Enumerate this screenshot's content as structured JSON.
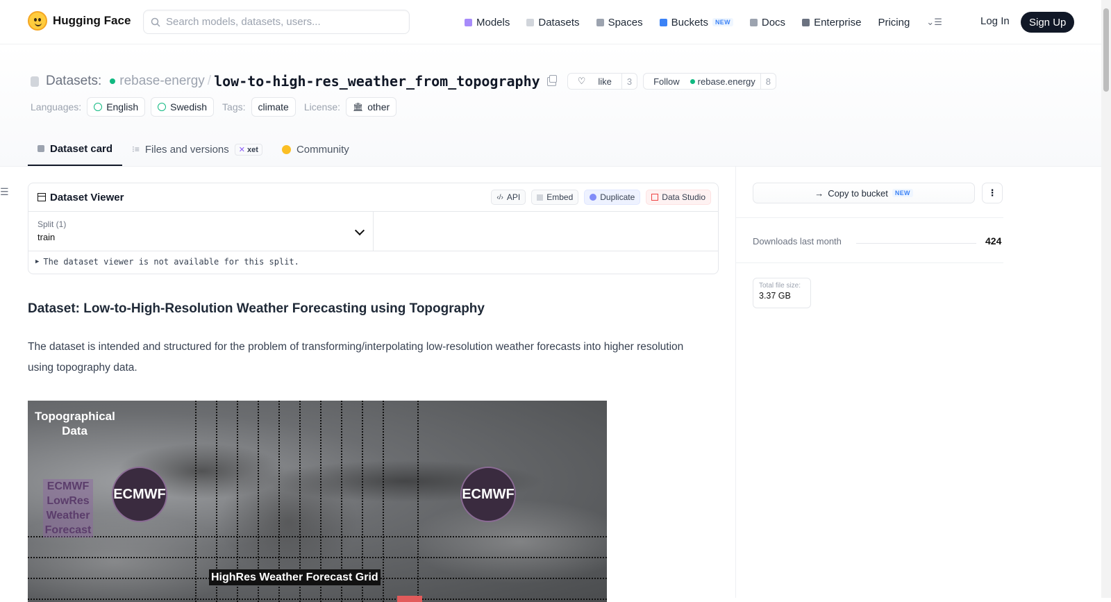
{
  "nav": {
    "logo_text": "Hugging Face",
    "search_placeholder": "Search models, datasets, users...",
    "items": [
      {
        "label": "Models",
        "icon": "models-icon",
        "color": "#a78bfa"
      },
      {
        "label": "Datasets",
        "icon": "datasets-icon",
        "color": "#d1d5db"
      },
      {
        "label": "Spaces",
        "icon": "spaces-icon",
        "color": "#9ca3af"
      },
      {
        "label": "Buckets",
        "icon": "buckets-icon",
        "color": "#3b82f6",
        "badge": "NEW"
      },
      {
        "label": "Docs",
        "icon": "docs-icon",
        "color": "#9ca3af"
      },
      {
        "label": "Enterprise",
        "icon": "enterprise-icon",
        "color": "#6b7280"
      },
      {
        "label": "Pricing"
      }
    ],
    "login": "Log In",
    "signup": "Sign Up"
  },
  "header": {
    "crumb": "Datasets:",
    "org": "rebase-energy",
    "repo": "low-to-high-res_weather_from_topography",
    "like_label": "like",
    "like_count": "3",
    "follow_label": "Follow",
    "follow_org": "rebase.energy",
    "follow_count": "8",
    "languages_label": "Languages:",
    "languages": [
      "English",
      "Swedish"
    ],
    "tags_label": "Tags:",
    "tags": [
      "climate"
    ],
    "license_label": "License:",
    "license": "other"
  },
  "tabs": [
    {
      "label": "Dataset card",
      "active": true
    },
    {
      "label": "Files and versions",
      "badge": "xet"
    },
    {
      "label": "Community"
    }
  ],
  "viewer": {
    "title": "Dataset Viewer",
    "buttons": [
      "API",
      "Embed",
      "Duplicate",
      "Data Studio"
    ],
    "split_label": "Split (1)",
    "split_value": "train",
    "not_available": "The dataset viewer is not available for this split."
  },
  "card": {
    "heading": "Dataset: Low-to-High-Resolution Weather Forecasting using Topography",
    "paragraph": "The dataset is intended and structured for the problem of transforming/interpolating low-resolution weather forecasts into higher resolution using topography data."
  },
  "figure": {
    "topo_label": "Topographical Data",
    "lowres_label": "ECMWF LowRes Weather Forecast",
    "circle_label": "ECMWF",
    "highres_label": "HighRes Weather Forecast Grid"
  },
  "sidebar": {
    "copy_bucket": "Copy to bucket",
    "copy_badge": "NEW",
    "downloads_label": "Downloads last month",
    "downloads_value": "424",
    "size_label": "Total file size:",
    "size_value": "3.37 GB"
  }
}
